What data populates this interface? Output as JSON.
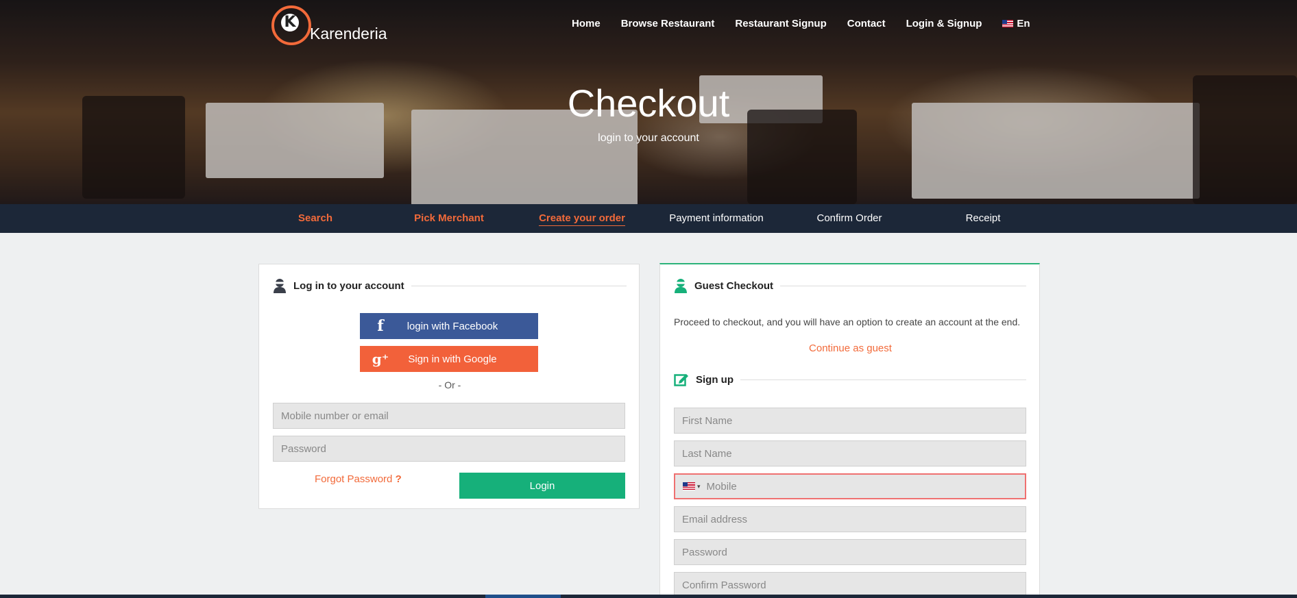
{
  "brand": {
    "name": "Karenderia",
    "logo_letter": "K",
    "accent": "#f26a3a"
  },
  "topnav": {
    "items": [
      "Home",
      "Browse Restaurant",
      "Restaurant Signup",
      "Contact",
      "Login & Signup"
    ],
    "language": "En"
  },
  "hero": {
    "title": "Checkout",
    "subtitle": "login to your account"
  },
  "steps": {
    "items": [
      "Search",
      "Pick Merchant",
      "Create your order",
      "Payment information",
      "Confirm Order",
      "Receipt"
    ],
    "current": "Create your order"
  },
  "login": {
    "heading": "Log in to your account",
    "facebook_label": "login with Facebook",
    "google_label": "Sign in with Google",
    "or_label": "- Or -",
    "username_placeholder": "Mobile number or email",
    "password_placeholder": "Password",
    "forgot_label": "Forgot Password",
    "forgot_mark": "?",
    "login_button": "Login"
  },
  "guest": {
    "heading": "Guest Checkout",
    "description": "Proceed to checkout, and you will have an option to create an account at the end.",
    "continue_label": "Continue as guest"
  },
  "signup": {
    "heading": "Sign up",
    "first_name_placeholder": "First Name",
    "last_name_placeholder": "Last Name",
    "mobile_placeholder": "Mobile",
    "email_placeholder": "Email address",
    "password_placeholder": "Password",
    "confirm_password_placeholder": "Confirm Password"
  },
  "colors": {
    "facebook": "#3b5998",
    "google": "#f2613a",
    "login": "#16b07a",
    "nav_bar": "#1c2738",
    "guest_accent": "#2bb37a"
  }
}
